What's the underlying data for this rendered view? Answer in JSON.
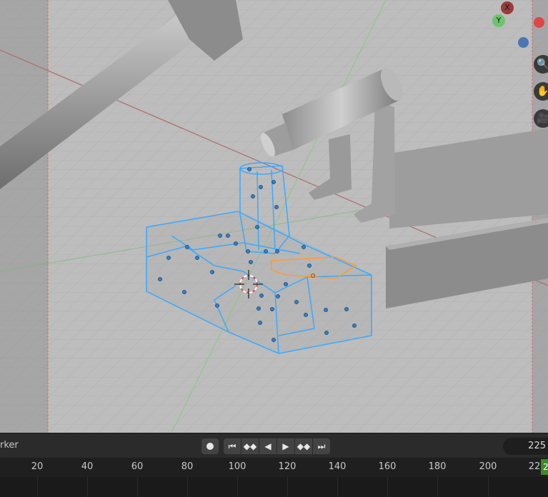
{
  "viewport": {
    "gizmo": {
      "x_label": "X",
      "y_label": "Y",
      "x_icon": "x-axis-icon",
      "y_icon": "y-axis-icon"
    },
    "nav_buttons": [
      {
        "name": "zoom-icon",
        "glyph": "🔍"
      },
      {
        "name": "pan-hand-icon",
        "glyph": "✋"
      },
      {
        "name": "camera-icon",
        "glyph": "🎥"
      }
    ],
    "colors": {
      "grid_bg": "#bdbdbd",
      "grid_line": "#a9a9a9",
      "x_axis": "#b06a6a",
      "y_axis": "#8ec98e",
      "mesh_select": "#3aa9ff",
      "active_face": "#ff9a2e"
    }
  },
  "timeline": {
    "marker_label": "rker",
    "current_frame": "225",
    "playhead_label": "2",
    "ruler_ticks": [
      "20",
      "40",
      "60",
      "80",
      "100",
      "120",
      "140",
      "160",
      "180",
      "200",
      "22"
    ],
    "transport": [
      {
        "name": "jump-start-icon",
        "glyph": "⏮"
      },
      {
        "name": "prev-keyframe-icon",
        "glyph": "◆◆"
      },
      {
        "name": "play-reverse-icon",
        "glyph": "◀"
      },
      {
        "name": "play-icon",
        "glyph": "▶"
      },
      {
        "name": "next-keyframe-icon",
        "glyph": "◆◆"
      },
      {
        "name": "jump-end-icon",
        "glyph": "⏭"
      }
    ]
  }
}
